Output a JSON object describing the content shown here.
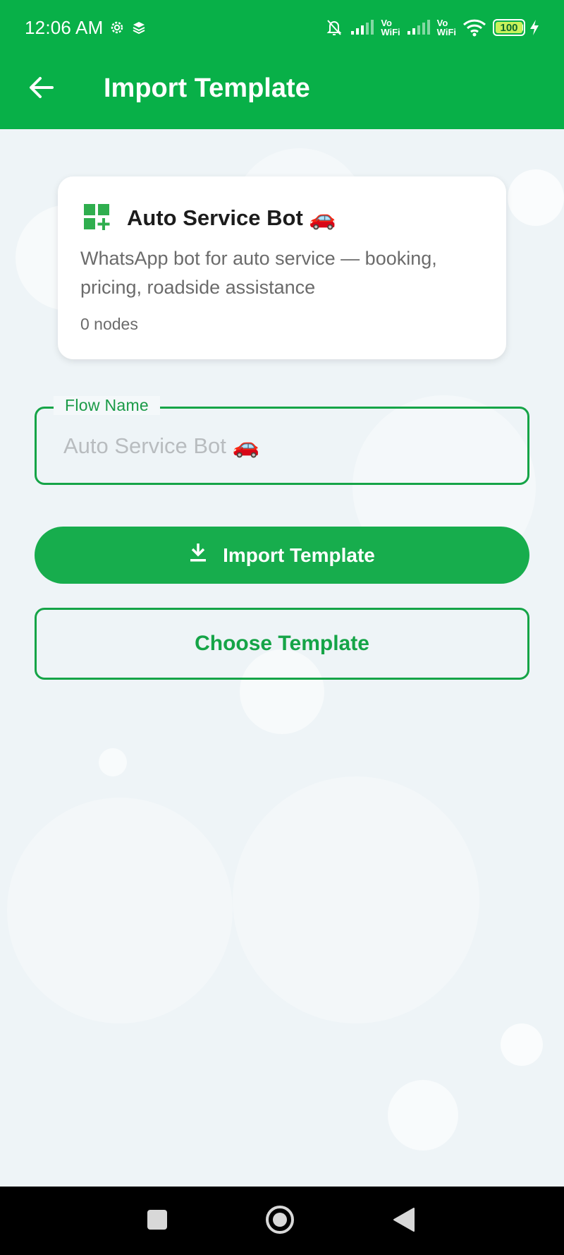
{
  "status_bar": {
    "time": "12:06 AM",
    "vowifi_label_1": "Vo\nWiFi",
    "vowifi_label_2": "Vo\nWiFi",
    "battery_level": "100",
    "icons": [
      "gear-icon",
      "layers-icon",
      "bell-off-icon",
      "signal-icon",
      "signal-icon",
      "wifi-icon",
      "battery-icon",
      "charging-icon"
    ]
  },
  "app_bar": {
    "title": "Import Template",
    "back_icon": "arrow-left-icon"
  },
  "template_card": {
    "icon": "widgets-add-icon",
    "title": "Auto Service Bot 🚗",
    "description": "WhatsApp bot for auto service — booking, pricing, roadside assistance",
    "nodes": "0 nodes"
  },
  "flow_name_field": {
    "label": "Flow Name",
    "value": "",
    "placeholder": "Auto Service Bot 🚗"
  },
  "buttons": {
    "import_label": "Import Template",
    "import_icon": "download-icon",
    "choose_label": "Choose Template"
  },
  "nav_bar": {
    "items": [
      "recents-square-icon",
      "home-circle-icon",
      "back-triangle-icon"
    ]
  },
  "colors": {
    "brand_green": "#08b048",
    "button_green": "#17ad4d",
    "outline_green": "#15a447"
  }
}
